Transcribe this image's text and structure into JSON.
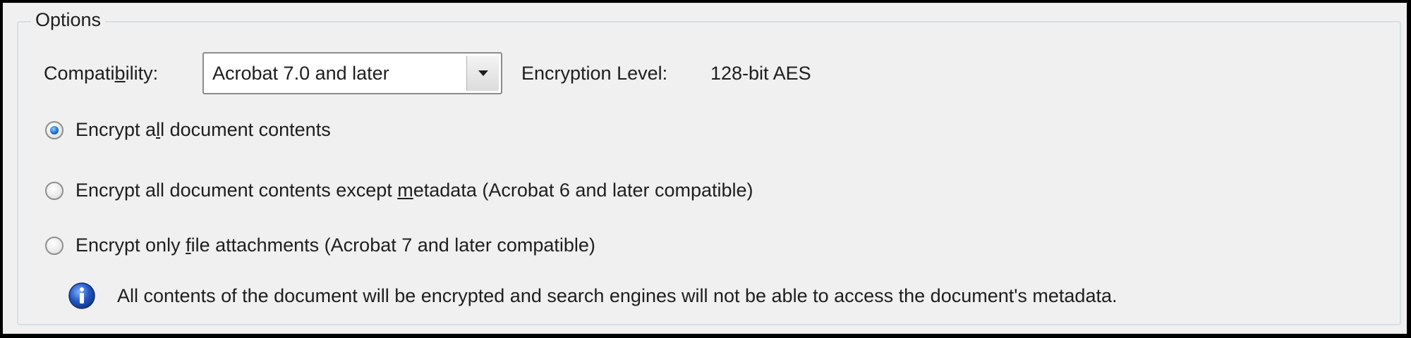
{
  "options": {
    "group_title": "Options",
    "compatibility_label_pre": "Compati",
    "compatibility_label_accel": "b",
    "compatibility_label_post": "ility:",
    "compatibility_value": "Acrobat 7.0 and later",
    "encryption_level_label": "Encryption  Level:",
    "encryption_level_value": "128-bit AES",
    "radios": [
      {
        "pre": "Encrypt a",
        "accel": "l",
        "post": "l document contents",
        "selected": true
      },
      {
        "pre": "Encrypt all document contents except ",
        "accel": "m",
        "post": "etadata (Acrobat 6 and later compatible)",
        "selected": false
      },
      {
        "pre": "Encrypt only ",
        "accel": "f",
        "post": "ile attachments (Acrobat 7 and later compatible)",
        "selected": false
      }
    ],
    "info_text": "All contents of the document will be encrypted and search engines will not be able to access the document's metadata."
  },
  "icons": {
    "info": "info-icon",
    "dropdown": "chevron-down-icon"
  },
  "colors": {
    "panel_bg": "#f0f0f0",
    "radio_selected": "#1e6fd6",
    "info_icon": "#2457c5"
  }
}
